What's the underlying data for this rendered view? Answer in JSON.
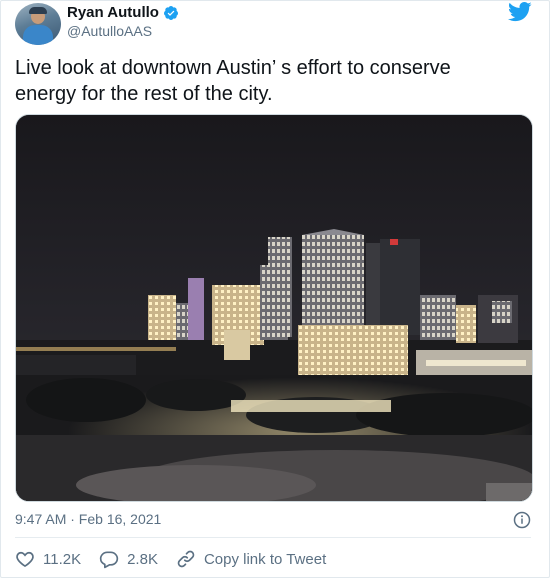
{
  "author": {
    "display_name": "Ryan Autullo",
    "handle": "@AutulloAAS"
  },
  "tweet": {
    "text": "Live look at downtown Austin’ s effort to conserve energy for the rest of the city.",
    "timestamp": "9:47 AM · Feb 16, 2021"
  },
  "actions": {
    "likes": "11.2K",
    "replies": "2.8K",
    "copy_link": "Copy link to Tweet"
  },
  "colors": {
    "twitter_blue": "#1da1f2",
    "secondary_text": "#5b7083"
  },
  "icons": [
    "verified-badge-icon",
    "twitter-bird-icon",
    "info-icon",
    "heart-icon",
    "reply-icon",
    "link-icon"
  ]
}
